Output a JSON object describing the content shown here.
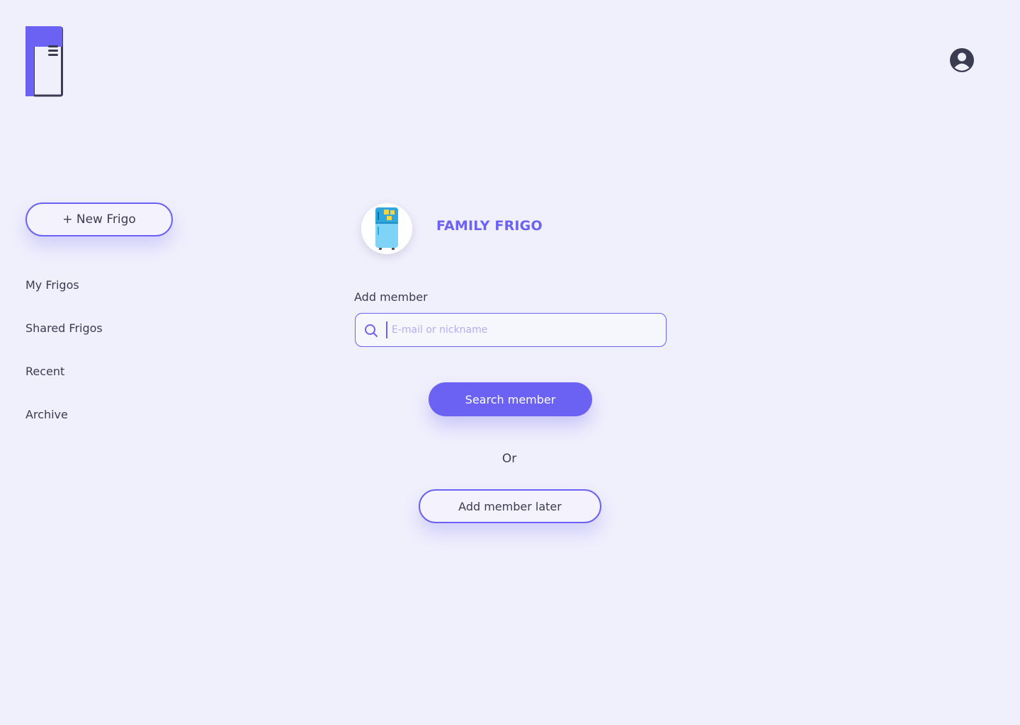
{
  "header": {
    "logo_icon": "fridge-logo-icon",
    "profile_icon": "user-circle-icon"
  },
  "sidebar": {
    "new_button_label": "+ New Frigo",
    "items": [
      {
        "label": "My Frigos"
      },
      {
        "label": "Shared Frigos"
      },
      {
        "label": "Recent"
      },
      {
        "label": "Archive"
      }
    ]
  },
  "main": {
    "frigo_icon": "fridge-icon",
    "frigo_name": "FAMILY FRIGO",
    "add_member_label": "Add member",
    "search": {
      "placeholder": "E-mail or nickname",
      "value": "",
      "icon": "search-icon"
    },
    "search_button_label": "Search member",
    "or_text": "Or",
    "later_button_label": "Add member later"
  },
  "colors": {
    "background": "#F0EFFC",
    "accent": "#6B62F4",
    "text": "#3B3B52",
    "placeholder": "#B3ACF1"
  }
}
